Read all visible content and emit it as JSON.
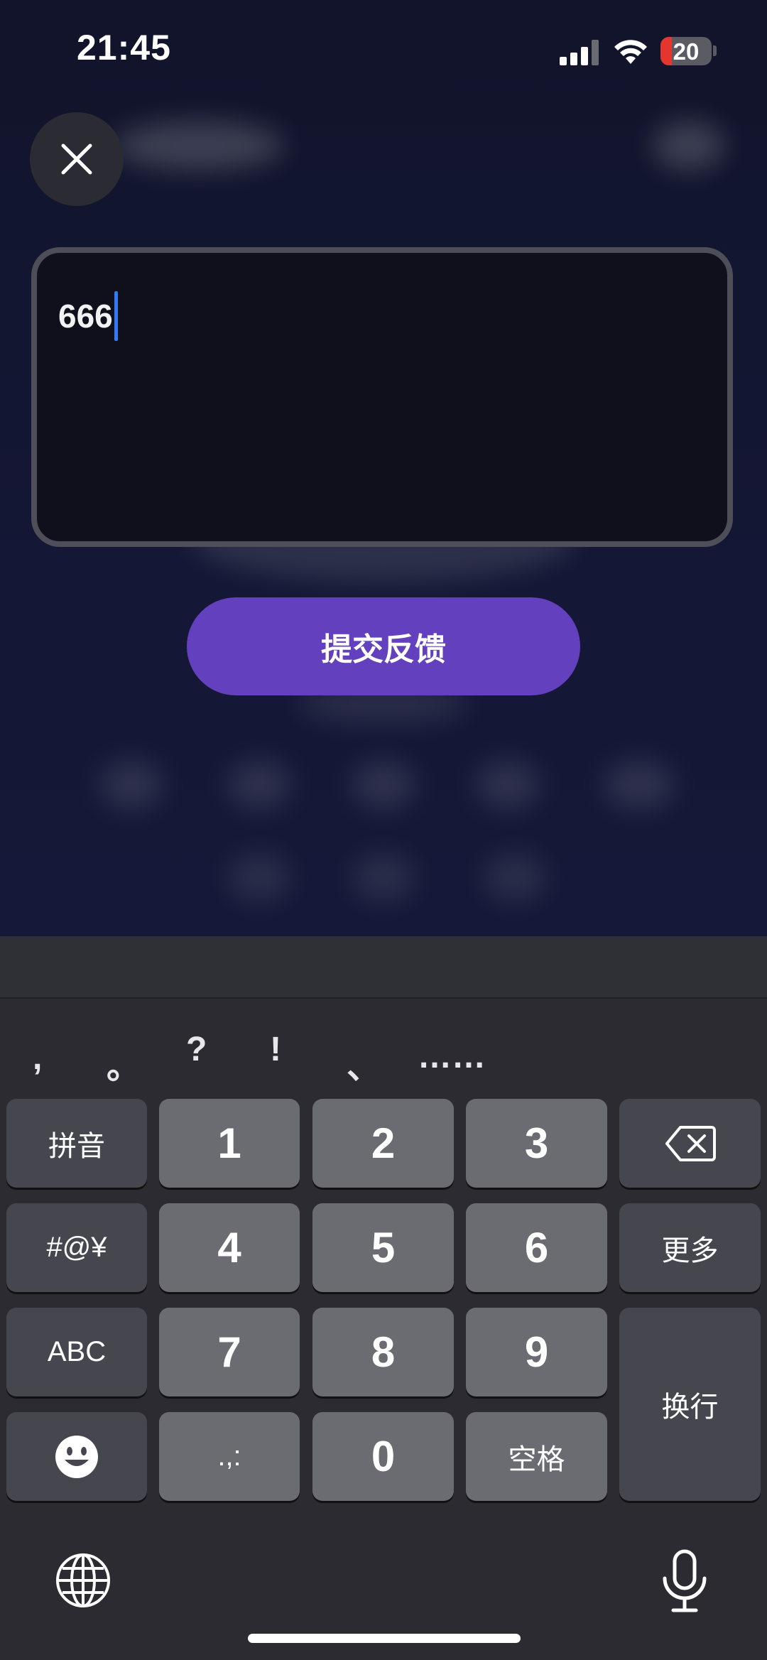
{
  "status_bar": {
    "time": "21:45",
    "battery": "20"
  },
  "feedback": {
    "text": "666"
  },
  "submit_label": "提交反馈",
  "keyboard": {
    "punctuation": [
      ",",
      "。",
      "?",
      "!",
      "、",
      "……"
    ],
    "keys": {
      "pinyin": "拼音",
      "symbols": "#@¥",
      "abc": "ABC",
      "more": "更多",
      "newline": "换行",
      "space": "空格",
      "punct": ".,:",
      "n1": "1",
      "n2": "2",
      "n3": "3",
      "n4": "4",
      "n5": "5",
      "n6": "6",
      "n7": "7",
      "n8": "8",
      "n9": "9",
      "n0": "0"
    }
  },
  "colors": {
    "accent": "#6340bd",
    "caret": "#2f7cf6",
    "battery_low": "#e5352f"
  }
}
